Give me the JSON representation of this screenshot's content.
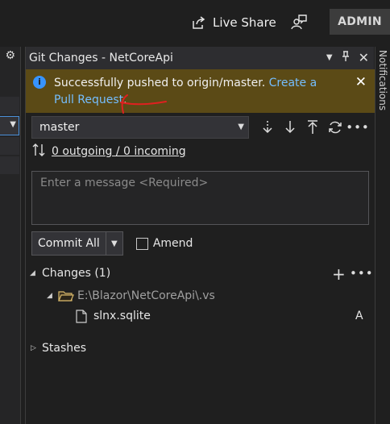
{
  "topbar": {
    "live_share_label": "Live Share",
    "admin_label": "ADMIN"
  },
  "panel": {
    "title": "Git Changes - NetCoreApi",
    "notification": {
      "message": "Successfully pushed to origin/master.",
      "link_label": "Create a Pull Request",
      "trailing": "."
    },
    "branch": {
      "selected": "master"
    },
    "sync": {
      "outgoing_incoming": "0 outgoing / 0 incoming"
    },
    "commit_message": {
      "placeholder": "Enter a message <Required>",
      "value": ""
    },
    "commit_button_label": "Commit All",
    "amend_label": "Amend",
    "amend_checked": false,
    "changes": {
      "header": "Changes (1)",
      "folder_path": "E:\\Blazor\\NetCoreApi\\.vs",
      "files": [
        {
          "name": "slnx.sqlite",
          "status": "A"
        }
      ]
    },
    "stashes_label": "Stashes"
  },
  "side_tab": {
    "notifications_label": "Notifications"
  },
  "colors": {
    "background": "#1f1f1f",
    "notification_bg": "#5b4a16",
    "link": "#75beff",
    "info_icon": "#3794ff",
    "annotation_red": "#e02020"
  }
}
